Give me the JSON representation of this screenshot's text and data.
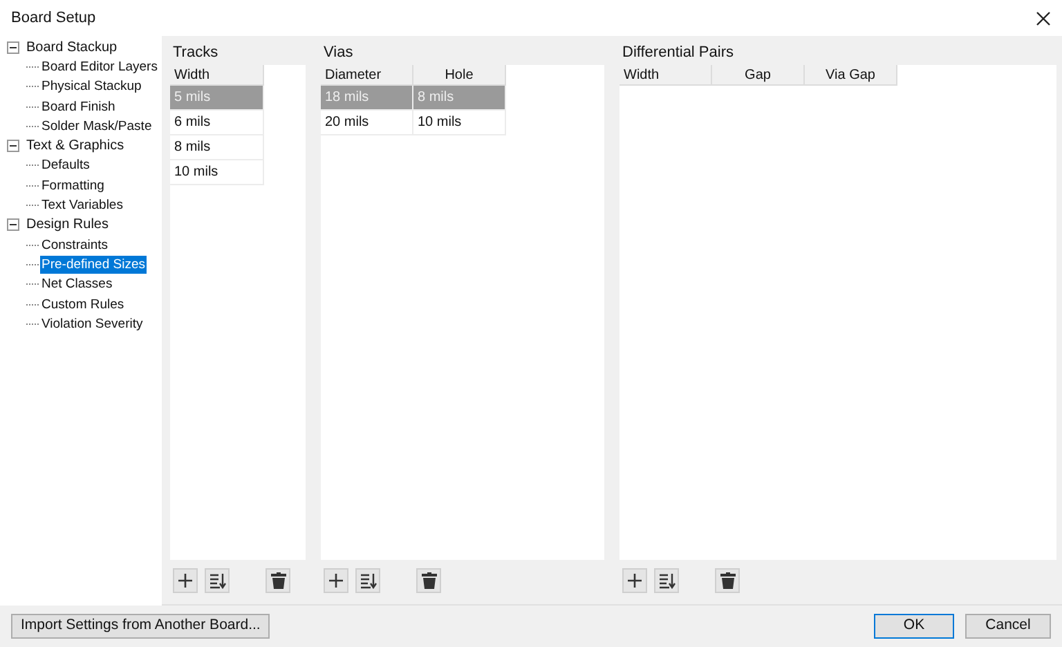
{
  "window": {
    "title": "Board Setup"
  },
  "tree": [
    {
      "label": "Board Stackup",
      "expanded": true,
      "selected": false,
      "children": [
        {
          "label": "Board Editor Layers",
          "selected": false
        },
        {
          "label": "Physical Stackup",
          "selected": false
        },
        {
          "label": "Board Finish",
          "selected": false
        },
        {
          "label": "Solder Mask/Paste",
          "selected": false
        }
      ]
    },
    {
      "label": "Text & Graphics",
      "expanded": true,
      "selected": false,
      "children": [
        {
          "label": "Defaults",
          "selected": false
        },
        {
          "label": "Formatting",
          "selected": false
        },
        {
          "label": "Text Variables",
          "selected": false
        }
      ]
    },
    {
      "label": "Design Rules",
      "expanded": true,
      "selected": false,
      "children": [
        {
          "label": "Constraints",
          "selected": false
        },
        {
          "label": "Pre-defined Sizes",
          "selected": true
        },
        {
          "label": "Net Classes",
          "selected": false
        },
        {
          "label": "Custom Rules",
          "selected": false
        },
        {
          "label": "Violation Severity",
          "selected": false
        }
      ]
    }
  ],
  "tables": [
    {
      "title": "Tracks",
      "columns": [
        "Width"
      ],
      "rows": [
        {
          "cells": [
            "5 mils"
          ],
          "selected": true
        },
        {
          "cells": [
            "6 mils"
          ],
          "selected": false
        },
        {
          "cells": [
            "8 mils"
          ],
          "selected": false
        },
        {
          "cells": [
            "10 mils"
          ],
          "selected": false
        }
      ]
    },
    {
      "title": "Vias",
      "columns": [
        "Diameter",
        "Hole"
      ],
      "rows": [
        {
          "cells": [
            "18 mils",
            "8 mils"
          ],
          "selected": true
        },
        {
          "cells": [
            "20 mils",
            "10 mils"
          ],
          "selected": false
        }
      ]
    },
    {
      "title": "Differential Pairs",
      "columns": [
        "Width",
        "Gap",
        "Via Gap"
      ]
    }
  ],
  "buttons": {
    "import": "Import Settings from Another Board...",
    "ok": "OK",
    "cancel": "Cancel"
  }
}
